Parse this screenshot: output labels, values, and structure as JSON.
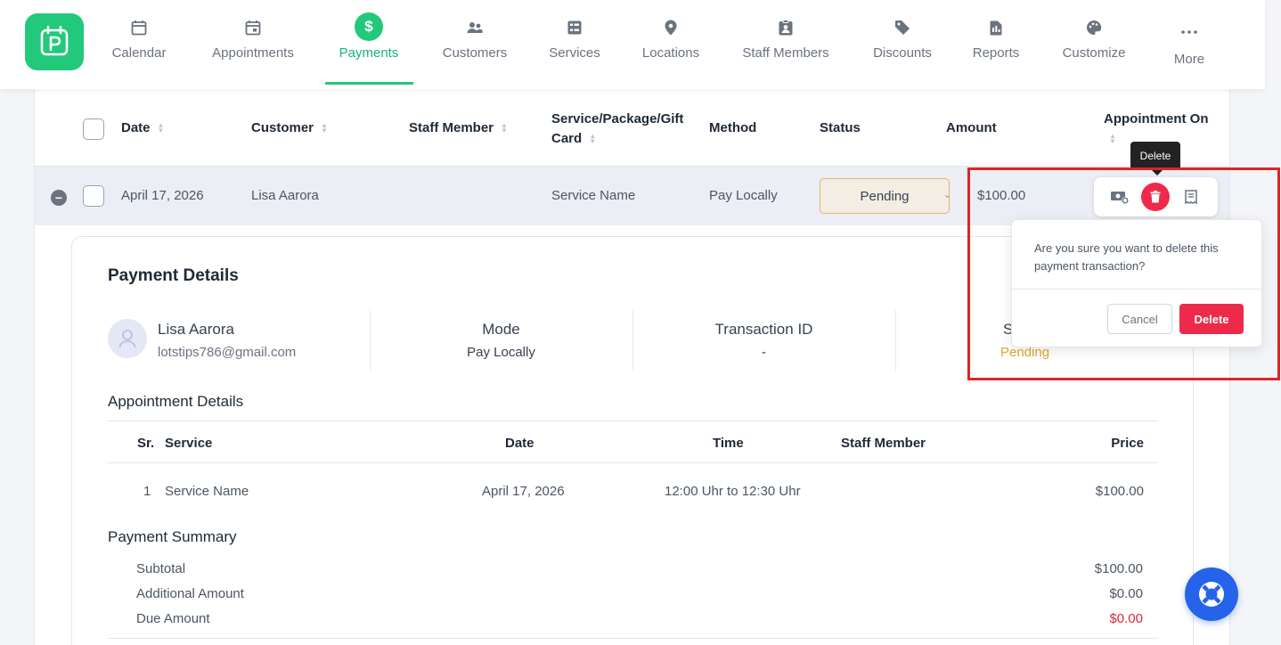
{
  "nav": {
    "items": [
      {
        "label": "Calendar",
        "icon": "calendar-icon"
      },
      {
        "label": "Appointments",
        "icon": "calendar-check-icon"
      },
      {
        "label": "Payments",
        "icon": "dollar-icon",
        "active": true
      },
      {
        "label": "Customers",
        "icon": "users-icon"
      },
      {
        "label": "Services",
        "icon": "grid-list-icon"
      },
      {
        "label": "Locations",
        "icon": "map-pin-icon"
      },
      {
        "label": "Staff Members",
        "icon": "id-badge-icon"
      },
      {
        "label": "Discounts",
        "icon": "tag-icon"
      },
      {
        "label": "Reports",
        "icon": "report-icon"
      },
      {
        "label": "Customize",
        "icon": "palette-icon"
      },
      {
        "label": "More",
        "icon": "ellipsis-icon"
      }
    ]
  },
  "table": {
    "columns": {
      "date": "Date",
      "customer": "Customer",
      "staff": "Staff Member",
      "service_line1": "Service/Package/Gift",
      "service_line2": "Card",
      "method": "Method",
      "status": "Status",
      "amount": "Amount",
      "appointment_on": "Appointment On"
    },
    "row": {
      "date": "April 17, 2026",
      "customer": "Lisa Aarora",
      "service": "Service Name",
      "method": "Pay Locally",
      "status": "Pending",
      "amount": "$100.00"
    }
  },
  "details": {
    "title": "Payment Details",
    "customer_name": "Lisa Aarora",
    "customer_email": "lotstips786@gmail.com",
    "mode_label": "Mode",
    "mode_value": "Pay Locally",
    "txn_label": "Transaction ID",
    "txn_value": "-",
    "status_label_partial": "S",
    "status_value": "Pending",
    "appointment_title": "Appointment Details",
    "appt_cols": {
      "sr": "Sr.",
      "service": "Service",
      "date": "Date",
      "time": "Time",
      "staff": "Staff Member",
      "price": "Price"
    },
    "appt_row": {
      "sr": "1",
      "service": "Service Name",
      "date": "April 17, 2026",
      "time": "12:00 Uhr to 12:30 Uhr",
      "staff": "",
      "price": "$100.00"
    },
    "summary_title": "Payment Summary",
    "summary": {
      "subtotal_label": "Subtotal",
      "subtotal": "$100.00",
      "additional_label": "Additional Amount",
      "additional": "$0.00",
      "due_label": "Due Amount",
      "due": "$0.00"
    }
  },
  "tooltip": "Delete",
  "popover": {
    "message": "Are you sure you want to delete this payment transaction?",
    "cancel": "Cancel",
    "delete": "Delete"
  },
  "colors": {
    "brand": "#22c97a",
    "danger": "#ee2a4a",
    "pending": "#e0a92b",
    "help": "#2563eb"
  }
}
